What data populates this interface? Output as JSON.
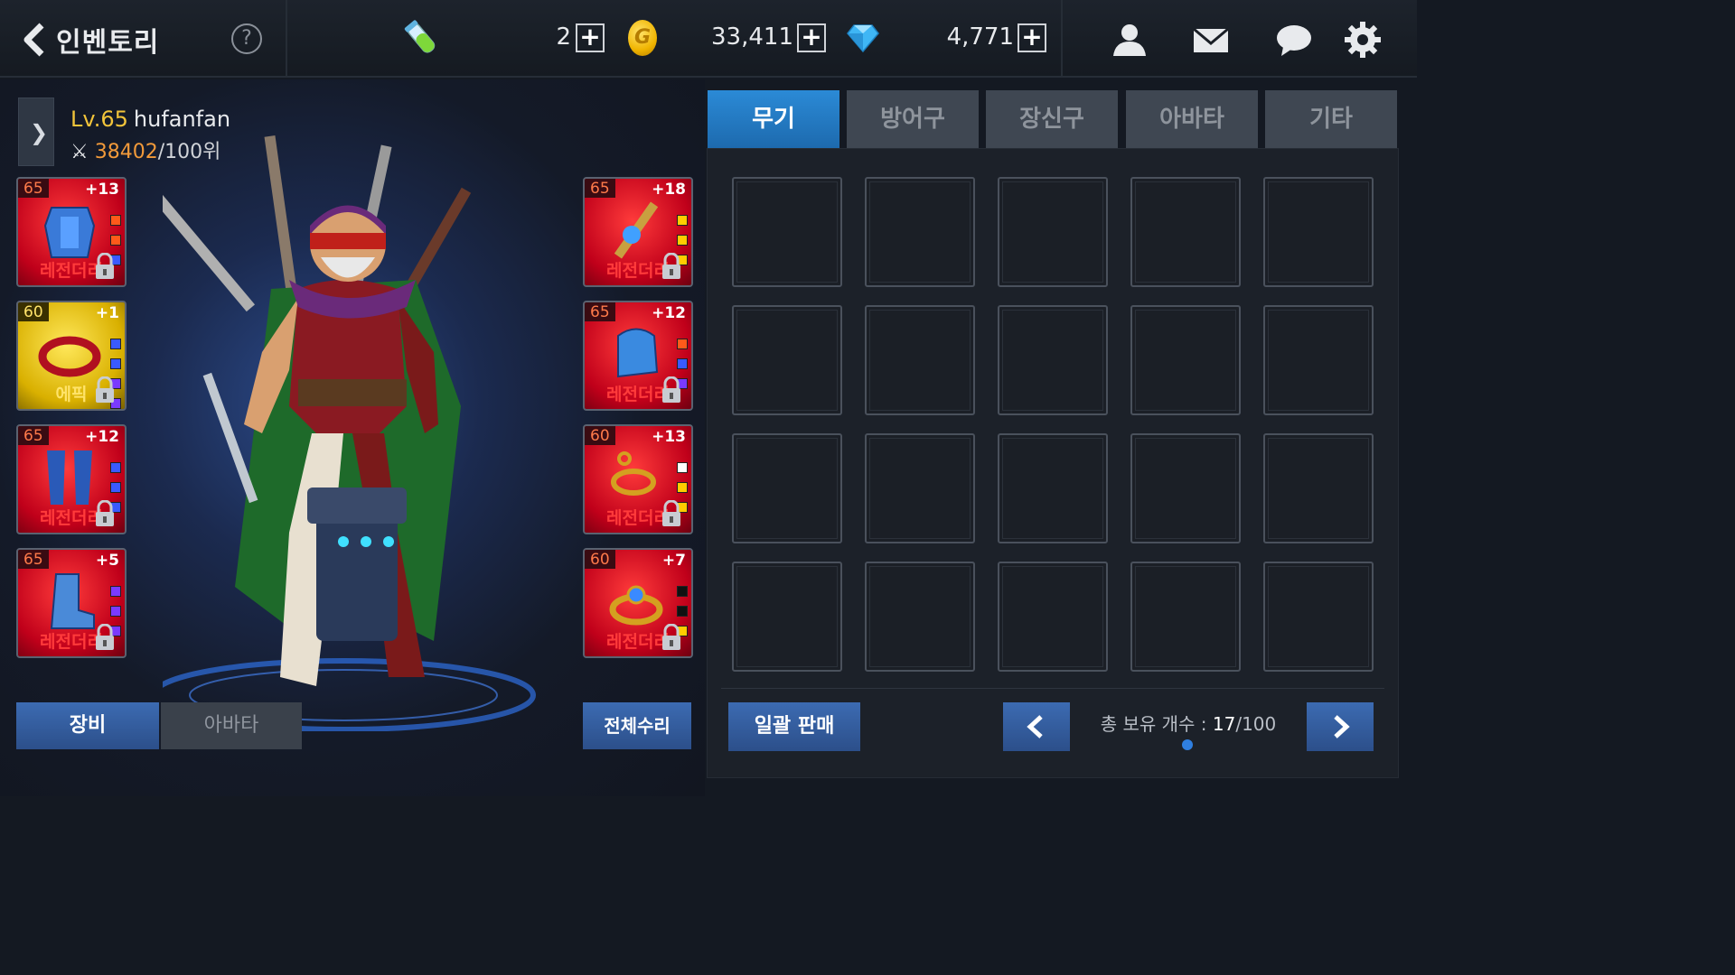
{
  "header": {
    "title": "인벤토리",
    "help_label": "?",
    "stamina": {
      "value": "2",
      "plus": "+"
    },
    "gold": {
      "value": "33,411",
      "plus": "+",
      "coin_letter": "G"
    },
    "gems": {
      "value": "4,771",
      "plus": "+"
    },
    "icons": [
      "back-icon",
      "stamina-vial-icon",
      "gold-coin-icon",
      "gem-icon",
      "friends-icon",
      "mail-icon",
      "chat-icon",
      "gear-icon"
    ]
  },
  "player": {
    "level": "Lv.65",
    "name": "hufanfan",
    "rank": "38402",
    "rank_suffix": "/100위"
  },
  "equipment_left": [
    {
      "level": "65",
      "enhance": "+13",
      "grade": "레전더리",
      "rarity": "legend",
      "item": "chest-armor",
      "sockets": [
        "#ff5a1a",
        "#ff5a1a",
        "#3a5aff"
      ]
    },
    {
      "level": "60",
      "enhance": "+1",
      "grade": "에픽",
      "rarity": "epic",
      "item": "necklace",
      "sockets": [
        "#3a5aff",
        "#3a5aff",
        "#7a3aff",
        "#7a3aff"
      ]
    },
    {
      "level": "65",
      "enhance": "+12",
      "grade": "레전더리",
      "rarity": "legend",
      "item": "leg-armor",
      "sockets": [
        "#3a5aff",
        "#3a5aff",
        "#3a5aff"
      ]
    },
    {
      "level": "65",
      "enhance": "+5",
      "grade": "레전더리",
      "rarity": "legend",
      "item": "boots",
      "sockets": [
        "#7a3aff",
        "#7a3aff",
        "#7a3aff"
      ]
    }
  ],
  "equipment_right": [
    {
      "level": "65",
      "enhance": "+18",
      "grade": "레전더리",
      "rarity": "legend",
      "item": "weapon",
      "sockets": [
        "#ffcc00",
        "#ffcc00",
        "#ffcc00"
      ]
    },
    {
      "level": "65",
      "enhance": "+12",
      "grade": "레전더리",
      "rarity": "legend",
      "item": "gauntlet",
      "sockets": [
        "#ff5a1a",
        "#3a5aff",
        "#7a3aff"
      ]
    },
    {
      "level": "60",
      "enhance": "+13",
      "grade": "레전더리",
      "rarity": "legend",
      "item": "earring",
      "sockets": [
        "#ffffff",
        "#ffcc00",
        "#ffcc00"
      ]
    },
    {
      "level": "60",
      "enhance": "+7",
      "grade": "레전더리",
      "rarity": "legend",
      "item": "ring",
      "sockets": [
        "#111111",
        "#111111",
        "#ffcc00"
      ]
    }
  ],
  "bottom_left": {
    "equip_tab": "장비",
    "avatar_tab": "아바타",
    "repair_all": "전체수리"
  },
  "inventory": {
    "tabs": [
      {
        "label": "무기",
        "active": true
      },
      {
        "label": "방어구",
        "active": false
      },
      {
        "label": "장신구",
        "active": false
      },
      {
        "label": "아바타",
        "active": false
      },
      {
        "label": "기타",
        "active": false
      }
    ],
    "bulk_sell": "일괄 판매",
    "count_label": "총 보유 개수 : ",
    "count_value": "17",
    "count_max": "/100",
    "page_indicator": "1 of 1"
  },
  "colors": {
    "accent_blue": "#2b8ad6",
    "button_blue": "#2c4f8a",
    "legend_red": "#c0001a",
    "epic_yellow": "#d9b000",
    "level_gold": "#f2c43a",
    "rank_orange": "#f29a3a"
  }
}
